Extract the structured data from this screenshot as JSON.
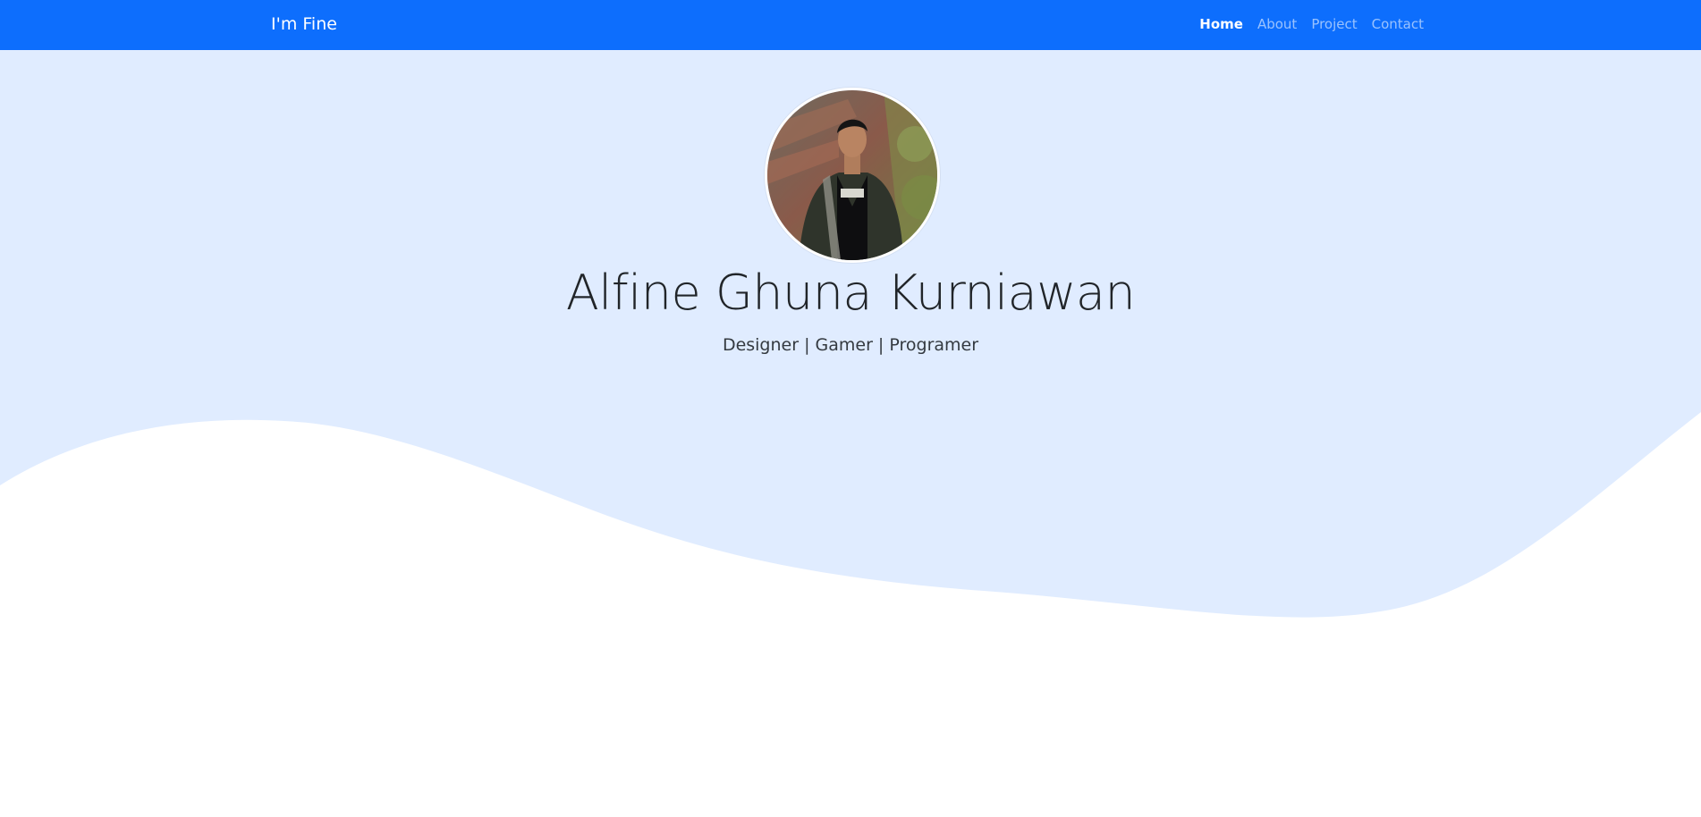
{
  "navbar": {
    "brand": "I'm Fine",
    "links": [
      {
        "label": "Home",
        "active": true
      },
      {
        "label": "About",
        "active": false
      },
      {
        "label": "Project",
        "active": false
      },
      {
        "label": "Contact",
        "active": false
      }
    ]
  },
  "hero": {
    "name": "Alfine Ghuna Kurniawan",
    "tagline": "Designer | Gamer | Programer"
  },
  "colors": {
    "navbar_bg": "#0d6efd",
    "hero_bg": "#e0ecff",
    "page_bg": "#ffffff"
  }
}
